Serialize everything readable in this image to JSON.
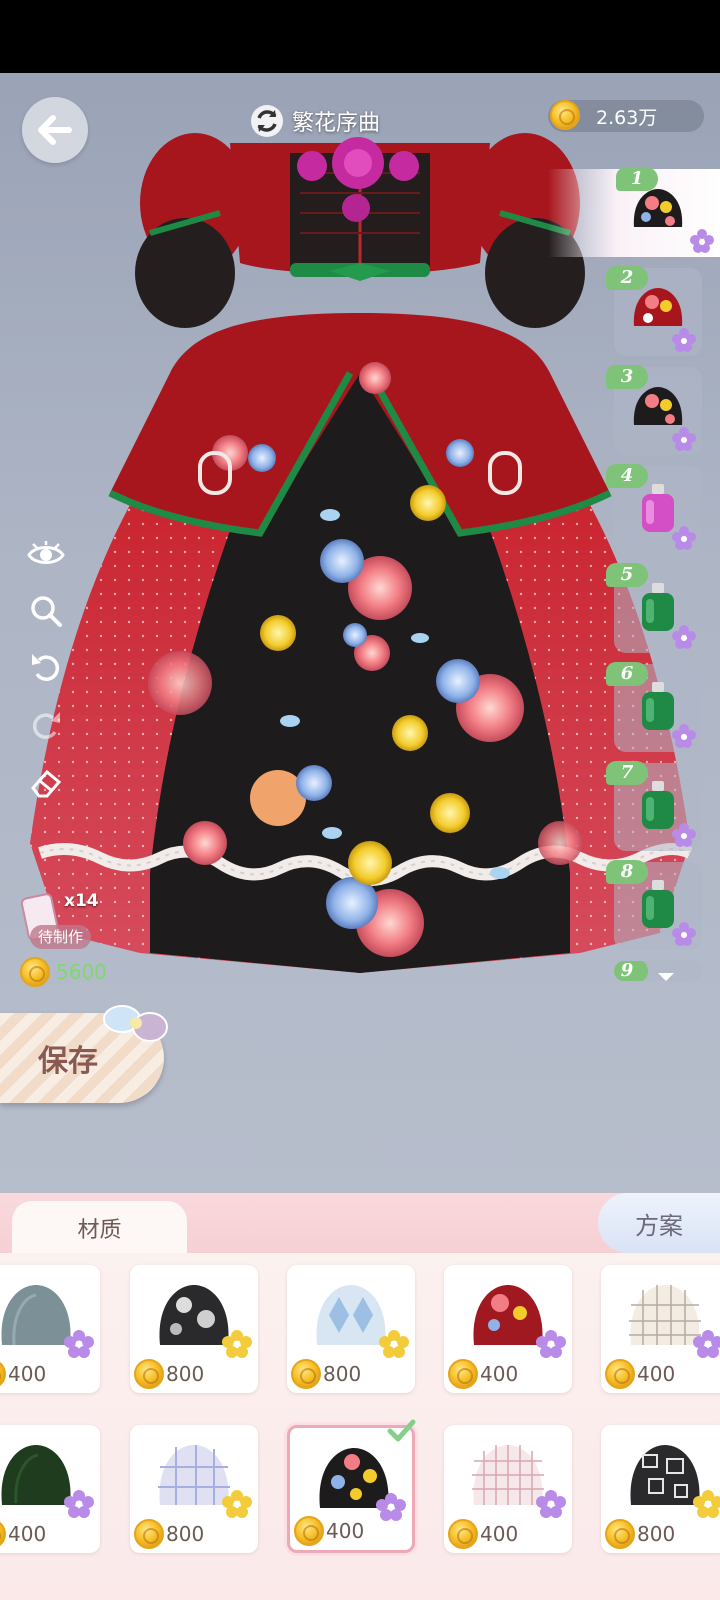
{
  "header": {
    "title": "繁花序曲",
    "currency_amount": "2.63万"
  },
  "left_tools": [
    {
      "name": "eye-icon"
    },
    {
      "name": "zoom-icon"
    },
    {
      "name": "undo-icon"
    },
    {
      "name": "redo-icon"
    },
    {
      "name": "eraser-icon"
    }
  ],
  "variants": [
    {
      "num": "1",
      "swatch": "floral-black",
      "selected": true
    },
    {
      "num": "2",
      "swatch": "floral-red"
    },
    {
      "num": "3",
      "swatch": "floral-black"
    },
    {
      "num": "4",
      "swatch": "bottle-pink"
    },
    {
      "num": "5",
      "swatch": "bottle-green"
    },
    {
      "num": "6",
      "swatch": "bottle-green"
    },
    {
      "num": "7",
      "swatch": "bottle-green"
    },
    {
      "num": "8",
      "swatch": "bottle-green"
    },
    {
      "num": "9",
      "swatch": "partial"
    }
  ],
  "pending": {
    "count": "x14",
    "label": "待制作"
  },
  "cost": "5600",
  "save_label": "保存",
  "tabs": {
    "material": "材质",
    "plan": "方案"
  },
  "materials": [
    {
      "price": "400",
      "fabric": "slate-blue",
      "rarity": "purple"
    },
    {
      "price": "800",
      "fabric": "black-splash",
      "rarity": "gold"
    },
    {
      "price": "800",
      "fabric": "blue-argyle",
      "rarity": "gold"
    },
    {
      "price": "400",
      "fabric": "red-floral",
      "rarity": "purple"
    },
    {
      "price": "400",
      "fabric": "cream-check",
      "rarity": "purple"
    },
    {
      "price": "400",
      "fabric": "dark-green",
      "rarity": "purple"
    },
    {
      "price": "800",
      "fabric": "lavender-plaid",
      "rarity": "gold"
    },
    {
      "price": "400",
      "fabric": "black-floral",
      "rarity": "purple",
      "selected": true
    },
    {
      "price": "400",
      "fabric": "pink-grid",
      "rarity": "purple"
    },
    {
      "price": "800",
      "fabric": "black-squares",
      "rarity": "gold"
    }
  ],
  "colors": {
    "coin_text": "#7fd86e",
    "variant_badge": "#7ec378",
    "select_border": "#efa8b4"
  }
}
